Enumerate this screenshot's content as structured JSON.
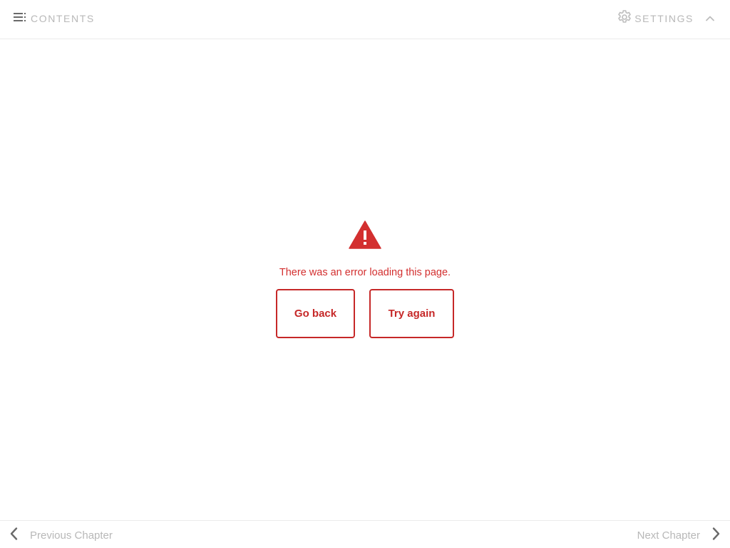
{
  "header": {
    "contents_label": "CONTENTS",
    "contents_icon": "toc-icon",
    "settings_label": "SETTINGS",
    "settings_icon": "gear-icon",
    "collapse_icon": "chevron-up-icon"
  },
  "error": {
    "icon": "warning-icon",
    "message": "There was an error loading this page.",
    "go_back_label": "Go back",
    "try_again_label": "Try again"
  },
  "footer": {
    "previous_label": "Previous Chapter",
    "previous_icon": "chevron-left-icon",
    "next_label": "Next Chapter",
    "next_icon": "chevron-right-icon"
  },
  "colors": {
    "error": "#d32f2f",
    "button_border": "#c62828",
    "muted_text": "#b8b8b8",
    "icon_dark": "#666666",
    "divider": "#ececec",
    "background": "#ffffff"
  }
}
